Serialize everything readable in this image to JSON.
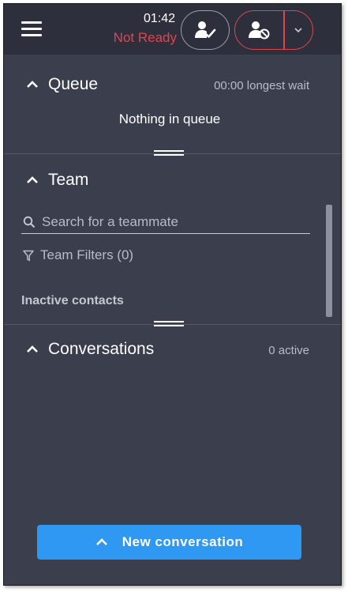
{
  "header": {
    "timer": "01:42",
    "status": "Not Ready",
    "ready_icon": "user-check-icon",
    "not_ready_icon": "user-blocked-icon",
    "dropdown_icon": "chevron-down-icon",
    "status_color": "#e0454e"
  },
  "queue": {
    "title": "Queue",
    "meta": "00:00 longest wait",
    "empty_text": "Nothing in queue"
  },
  "team": {
    "title": "Team",
    "search_placeholder": "Search for a teammate",
    "filters_label": "Team Filters (0)",
    "inactive_label": "Inactive contacts"
  },
  "conversations": {
    "title": "Conversations",
    "meta": "0 active",
    "new_button_label": "New conversation"
  },
  "colors": {
    "panel_bg": "#3b3e4d",
    "header_bg": "#2d2f3d",
    "accent": "#2e98f2"
  }
}
